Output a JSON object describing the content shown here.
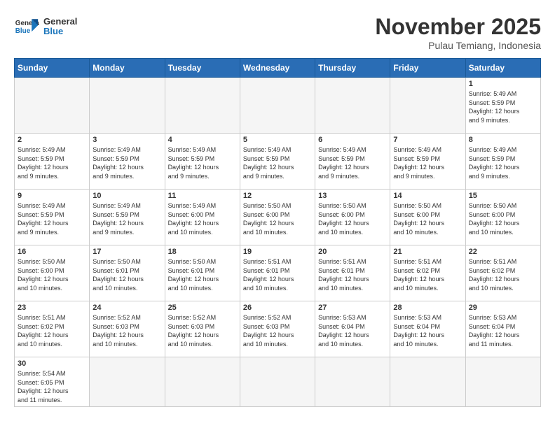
{
  "logo": {
    "general": "General",
    "blue": "Blue"
  },
  "title": "November 2025",
  "subtitle": "Pulau Temiang, Indonesia",
  "days_header": [
    "Sunday",
    "Monday",
    "Tuesday",
    "Wednesday",
    "Thursday",
    "Friday",
    "Saturday"
  ],
  "weeks": [
    [
      {
        "day": "",
        "info": ""
      },
      {
        "day": "",
        "info": ""
      },
      {
        "day": "",
        "info": ""
      },
      {
        "day": "",
        "info": ""
      },
      {
        "day": "",
        "info": ""
      },
      {
        "day": "",
        "info": ""
      },
      {
        "day": "1",
        "info": "Sunrise: 5:49 AM\nSunset: 5:59 PM\nDaylight: 12 hours\nand 9 minutes."
      }
    ],
    [
      {
        "day": "2",
        "info": "Sunrise: 5:49 AM\nSunset: 5:59 PM\nDaylight: 12 hours\nand 9 minutes."
      },
      {
        "day": "3",
        "info": "Sunrise: 5:49 AM\nSunset: 5:59 PM\nDaylight: 12 hours\nand 9 minutes."
      },
      {
        "day": "4",
        "info": "Sunrise: 5:49 AM\nSunset: 5:59 PM\nDaylight: 12 hours\nand 9 minutes."
      },
      {
        "day": "5",
        "info": "Sunrise: 5:49 AM\nSunset: 5:59 PM\nDaylight: 12 hours\nand 9 minutes."
      },
      {
        "day": "6",
        "info": "Sunrise: 5:49 AM\nSunset: 5:59 PM\nDaylight: 12 hours\nand 9 minutes."
      },
      {
        "day": "7",
        "info": "Sunrise: 5:49 AM\nSunset: 5:59 PM\nDaylight: 12 hours\nand 9 minutes."
      },
      {
        "day": "8",
        "info": "Sunrise: 5:49 AM\nSunset: 5:59 PM\nDaylight: 12 hours\nand 9 minutes."
      }
    ],
    [
      {
        "day": "9",
        "info": "Sunrise: 5:49 AM\nSunset: 5:59 PM\nDaylight: 12 hours\nand 9 minutes."
      },
      {
        "day": "10",
        "info": "Sunrise: 5:49 AM\nSunset: 5:59 PM\nDaylight: 12 hours\nand 9 minutes."
      },
      {
        "day": "11",
        "info": "Sunrise: 5:49 AM\nSunset: 6:00 PM\nDaylight: 12 hours\nand 10 minutes."
      },
      {
        "day": "12",
        "info": "Sunrise: 5:50 AM\nSunset: 6:00 PM\nDaylight: 12 hours\nand 10 minutes."
      },
      {
        "day": "13",
        "info": "Sunrise: 5:50 AM\nSunset: 6:00 PM\nDaylight: 12 hours\nand 10 minutes."
      },
      {
        "day": "14",
        "info": "Sunrise: 5:50 AM\nSunset: 6:00 PM\nDaylight: 12 hours\nand 10 minutes."
      },
      {
        "day": "15",
        "info": "Sunrise: 5:50 AM\nSunset: 6:00 PM\nDaylight: 12 hours\nand 10 minutes."
      }
    ],
    [
      {
        "day": "16",
        "info": "Sunrise: 5:50 AM\nSunset: 6:00 PM\nDaylight: 12 hours\nand 10 minutes."
      },
      {
        "day": "17",
        "info": "Sunrise: 5:50 AM\nSunset: 6:01 PM\nDaylight: 12 hours\nand 10 minutes."
      },
      {
        "day": "18",
        "info": "Sunrise: 5:50 AM\nSunset: 6:01 PM\nDaylight: 12 hours\nand 10 minutes."
      },
      {
        "day": "19",
        "info": "Sunrise: 5:51 AM\nSunset: 6:01 PM\nDaylight: 12 hours\nand 10 minutes."
      },
      {
        "day": "20",
        "info": "Sunrise: 5:51 AM\nSunset: 6:01 PM\nDaylight: 12 hours\nand 10 minutes."
      },
      {
        "day": "21",
        "info": "Sunrise: 5:51 AM\nSunset: 6:02 PM\nDaylight: 12 hours\nand 10 minutes."
      },
      {
        "day": "22",
        "info": "Sunrise: 5:51 AM\nSunset: 6:02 PM\nDaylight: 12 hours\nand 10 minutes."
      }
    ],
    [
      {
        "day": "23",
        "info": "Sunrise: 5:51 AM\nSunset: 6:02 PM\nDaylight: 12 hours\nand 10 minutes."
      },
      {
        "day": "24",
        "info": "Sunrise: 5:52 AM\nSunset: 6:03 PM\nDaylight: 12 hours\nand 10 minutes."
      },
      {
        "day": "25",
        "info": "Sunrise: 5:52 AM\nSunset: 6:03 PM\nDaylight: 12 hours\nand 10 minutes."
      },
      {
        "day": "26",
        "info": "Sunrise: 5:52 AM\nSunset: 6:03 PM\nDaylight: 12 hours\nand 10 minutes."
      },
      {
        "day": "27",
        "info": "Sunrise: 5:53 AM\nSunset: 6:04 PM\nDaylight: 12 hours\nand 10 minutes."
      },
      {
        "day": "28",
        "info": "Sunrise: 5:53 AM\nSunset: 6:04 PM\nDaylight: 12 hours\nand 10 minutes."
      },
      {
        "day": "29",
        "info": "Sunrise: 5:53 AM\nSunset: 6:04 PM\nDaylight: 12 hours\nand 11 minutes."
      }
    ],
    [
      {
        "day": "30",
        "info": "Sunrise: 5:54 AM\nSunset: 6:05 PM\nDaylight: 12 hours\nand 11 minutes."
      },
      {
        "day": "",
        "info": ""
      },
      {
        "day": "",
        "info": ""
      },
      {
        "day": "",
        "info": ""
      },
      {
        "day": "",
        "info": ""
      },
      {
        "day": "",
        "info": ""
      },
      {
        "day": "",
        "info": ""
      }
    ]
  ]
}
